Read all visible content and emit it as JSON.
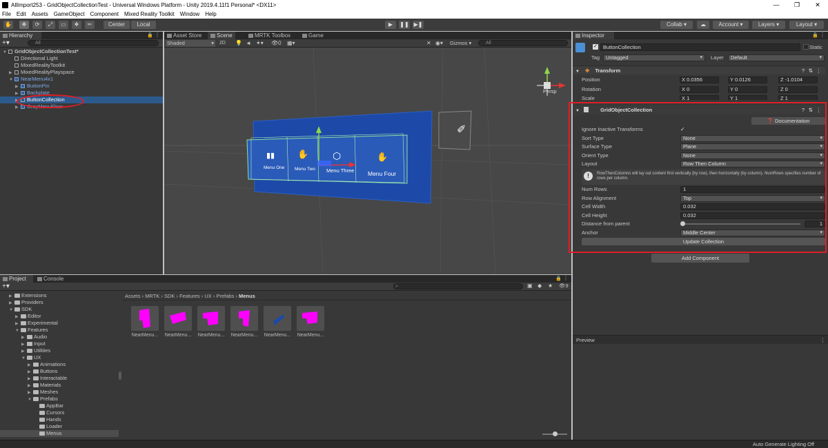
{
  "window": {
    "title": "AllImport253 - GridObjectCollectionTest - Universal Windows Platform - Unity 2019.4.11f1 Personal* <DX11>"
  },
  "menubar": [
    "File",
    "Edit",
    "Assets",
    "GameObject",
    "Component",
    "Mixed Reality Toolkit",
    "Window",
    "Help"
  ],
  "toolbar": {
    "center": "Center",
    "local": "Local",
    "collab": "Collab",
    "account": "Account",
    "layers": "Layers",
    "layout": "Layout"
  },
  "hierarchy": {
    "tab": "Hierarchy",
    "search_placeholder": "All",
    "items": [
      {
        "label": "GridObjectCollectionTest*",
        "depth": 0,
        "bold": true
      },
      {
        "label": "Directional Light",
        "depth": 1
      },
      {
        "label": "MixedRealityToolkit",
        "depth": 1
      },
      {
        "label": "MixedRealityPlayspace",
        "depth": 1
      },
      {
        "label": "NearMenu4x1",
        "depth": 1,
        "blue": true
      },
      {
        "label": "ButtonPin",
        "depth": 2,
        "blue": true
      },
      {
        "label": "Backplate",
        "depth": 2,
        "blue": true
      },
      {
        "label": "ButtonCollection",
        "depth": 2,
        "selected": true
      },
      {
        "label": "GrayMenuFloor",
        "depth": 2,
        "blue": true
      }
    ]
  },
  "scene": {
    "tabs": [
      "Asset Store",
      "Scene",
      "MRTK Toolbox",
      "Game"
    ],
    "shading": "Shaded",
    "mode_2d": "2D",
    "gizmos": "Gizmos",
    "search_placeholder": "All",
    "persp": "Persp",
    "buttons": [
      "Menu One",
      "Menu Two",
      "Menu Three",
      "Menu Four"
    ]
  },
  "inspector": {
    "tab": "Inspector",
    "object_name": "ButtonCollection",
    "static_label": "Static",
    "tag_label": "Tag",
    "tag_value": "Untagged",
    "layer_label": "Layer",
    "layer_value": "Default",
    "transform": {
      "title": "Transform",
      "position_label": "Position",
      "pos": [
        "X 0.0356",
        "Y 0.0126",
        "Z -1.0104"
      ],
      "rotation_label": "Rotation",
      "rot": [
        "X 0",
        "Y 0",
        "Z 0"
      ],
      "scale_label": "Scale",
      "scale": [
        "X 1",
        "Y 1",
        "Z 1"
      ]
    },
    "goc": {
      "title": "GridObjectCollection",
      "documentation": "Documentation",
      "fields": [
        {
          "label": "Ignore Inactive Transforms",
          "value": "✓",
          "type": "check"
        },
        {
          "label": "Sort Type",
          "value": "None",
          "type": "drop"
        },
        {
          "label": "Surface Type",
          "value": "Plane",
          "type": "drop"
        },
        {
          "label": "Orient Type",
          "value": "None",
          "type": "drop"
        },
        {
          "label": "Layout",
          "value": "Row Then Column",
          "type": "drop"
        }
      ],
      "info": "RowThenColumns will lay out content first vertically (by row), then horizontally (by column). NumRows specifies number of rows per column.",
      "fields2": [
        {
          "label": "Num Rows",
          "value": "1",
          "type": "text"
        },
        {
          "label": "Row Alignment",
          "value": "Top",
          "type": "drop"
        },
        {
          "label": "Cell Width",
          "value": "0.032",
          "type": "text"
        },
        {
          "label": "Cell Height",
          "value": "0.032",
          "type": "text"
        },
        {
          "label": "Distance from parent",
          "value": "1",
          "type": "slider"
        },
        {
          "label": "Anchor",
          "value": "Middle Center",
          "type": "drop"
        }
      ],
      "update_button": "Update Collection"
    },
    "add_component": "Add Component",
    "preview": "Preview"
  },
  "project": {
    "tabs": [
      "Project",
      "Console"
    ],
    "badge": "9",
    "breadcrumb": [
      "Assets",
      "MRTK",
      "SDK",
      "Features",
      "UX",
      "Prefabs",
      "Menus"
    ],
    "tree": [
      {
        "label": "Extensions",
        "depth": 1
      },
      {
        "label": "Providers",
        "depth": 1
      },
      {
        "label": "SDK",
        "depth": 1,
        "open": true
      },
      {
        "label": "Editor",
        "depth": 2
      },
      {
        "label": "Experimental",
        "depth": 2
      },
      {
        "label": "Features",
        "depth": 2,
        "open": true
      },
      {
        "label": "Audio",
        "depth": 3
      },
      {
        "label": "Input",
        "depth": 3
      },
      {
        "label": "Utilities",
        "depth": 3
      },
      {
        "label": "UX",
        "depth": 3,
        "open": true
      },
      {
        "label": "Animations",
        "depth": 4
      },
      {
        "label": "Buttons",
        "depth": 4
      },
      {
        "label": "Interactable",
        "depth": 4
      },
      {
        "label": "Materials",
        "depth": 4
      },
      {
        "label": "Meshes",
        "depth": 4
      },
      {
        "label": "Prefabs",
        "depth": 4,
        "open": true
      },
      {
        "label": "AppBar",
        "depth": 5
      },
      {
        "label": "Cursors",
        "depth": 5
      },
      {
        "label": "Hands",
        "depth": 5
      },
      {
        "label": "Loader",
        "depth": 5
      },
      {
        "label": "Menus",
        "depth": 5,
        "selected": true
      }
    ],
    "assets": [
      "NearMenu...",
      "NearMenu...",
      "NearMenu...",
      "NearMenu...",
      "NearMenu...",
      "NearMenu..."
    ]
  },
  "status": {
    "text": "Auto Generate Lighting Off"
  },
  "colors": {
    "highlight": "#e01e28",
    "selection": "#2d5a8c",
    "magenta": "#ff00ff"
  }
}
